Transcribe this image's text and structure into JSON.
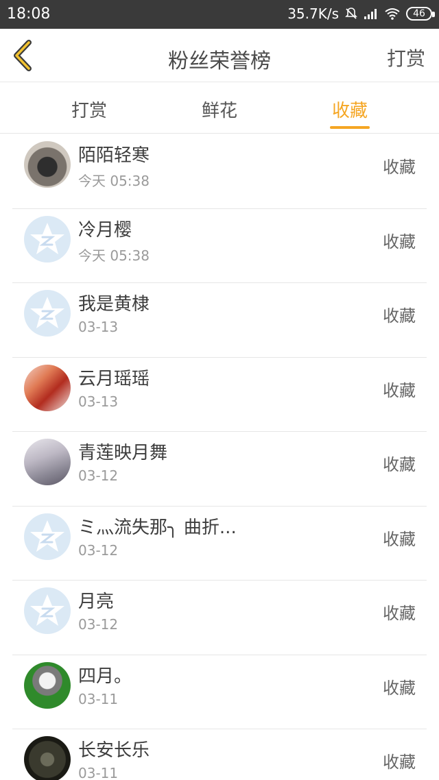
{
  "status_bar": {
    "time": "18:08",
    "network_speed": "35.7K/s",
    "battery_level": "46"
  },
  "header": {
    "title": "粉丝荣誉榜",
    "action_label": "打赏",
    "back_icon": "chevron-left-icon"
  },
  "tabs": [
    {
      "label": "打赏",
      "active": false
    },
    {
      "label": "鲜花",
      "active": false
    },
    {
      "label": "收藏",
      "active": true
    }
  ],
  "colors": {
    "accent": "#f5a623",
    "status_bar": "#3a3a3a",
    "divider": "#e6e6e6"
  },
  "fans": [
    {
      "name": "陌陌轻寒",
      "date": "今天 05:38",
      "action": "收藏",
      "avatar": "cat-photo"
    },
    {
      "name": "冷月樱",
      "date": "今天 05:38",
      "action": "收藏",
      "avatar": "default-star"
    },
    {
      "name": "我是黄棣",
      "date": "03-13",
      "action": "收藏",
      "avatar": "default-star"
    },
    {
      "name": "云月瑶瑶",
      "date": "03-13",
      "action": "收藏",
      "avatar": "anime-red-hair"
    },
    {
      "name": "青莲映月舞",
      "date": "03-12",
      "action": "收藏",
      "avatar": "anime-silver-hair"
    },
    {
      "name": "ミ灬流失那╮ 曲折...",
      "date": "03-12",
      "action": "收藏",
      "avatar": "default-star"
    },
    {
      "name": "月亮",
      "date": "03-12",
      "action": "收藏",
      "avatar": "default-star"
    },
    {
      "name": "四月。",
      "date": "03-11",
      "action": "收藏",
      "avatar": "anime-green"
    },
    {
      "name": "长安长乐",
      "date": "03-11",
      "action": "收藏",
      "avatar": "soldier-photo"
    }
  ]
}
